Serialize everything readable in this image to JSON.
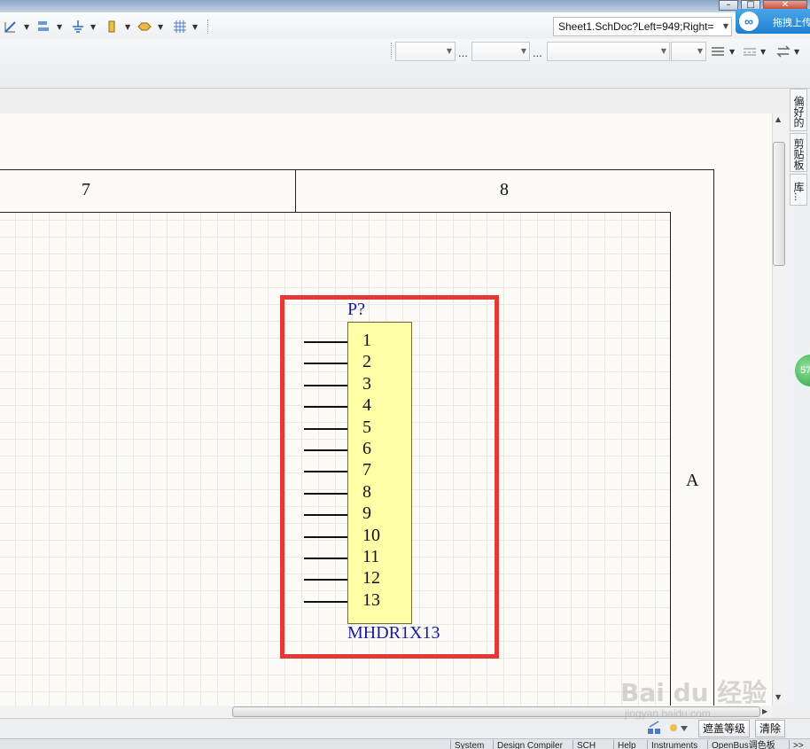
{
  "toolbar": {
    "document_combo": "Sheet1.SchDoc?Left=949;Right=",
    "dots_1": "...",
    "dots_2": "...",
    "cloud_label": "拖拽上传"
  },
  "side_tabs": [
    "偏好的",
    "剪贴板",
    "库..."
  ],
  "badge_text": "57",
  "sheet": {
    "zone_labels": [
      "7",
      "8"
    ],
    "row_label": "A"
  },
  "component": {
    "designator": "P?",
    "comment": "MHDR1X13",
    "pins": [
      "1",
      "2",
      "3",
      "4",
      "5",
      "6",
      "7",
      "8",
      "9",
      "10",
      "11",
      "12",
      "13"
    ]
  },
  "bottom_bar": {
    "mask_level": "遮盖等级",
    "clear": "清除"
  },
  "status_tabs": [
    "System",
    "Design Compiler",
    "SCH",
    "Help",
    "Instruments",
    "OpenBus调色板"
  ],
  "watermark": {
    "main": "Bai du 经验",
    "sub": "jingyan.baidu.com"
  },
  "colors": {
    "highlight": "#e53935",
    "component_fill": "#ffffa8",
    "designator_text": "#1a1aa0"
  }
}
